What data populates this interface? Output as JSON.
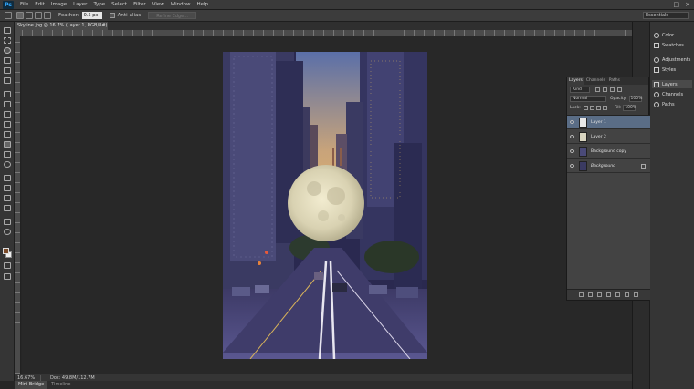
{
  "menubar": {
    "logo": "Ps",
    "items": [
      "File",
      "Edit",
      "Image",
      "Layer",
      "Type",
      "Select",
      "Filter",
      "View",
      "Window",
      "Help"
    ],
    "window_controls": [
      "–",
      "□",
      "×"
    ]
  },
  "options": {
    "feather_label": "Feather:",
    "feather_value": "0.5 px",
    "anti_alias_label": "Anti-alias",
    "refine_edge_label": "Refine Edge...",
    "workspace": "Essentials"
  },
  "document": {
    "tab_title": "Skyline.jpg @ 16.7% (Layer 1, RGB/8#) ×",
    "zoom": "16.67%",
    "doc_size": "Doc: 49.8M/112.7M"
  },
  "bottom_tabs": [
    "Mini Bridge",
    "Timeline"
  ],
  "dock": {
    "items": [
      "Color",
      "Swatches",
      "Adjustments",
      "Styles",
      "Layers",
      "Channels",
      "Paths"
    ]
  },
  "layers_panel": {
    "tabs": [
      "Layers",
      "Channels",
      "Paths"
    ],
    "filter_kind": "Kind",
    "blend_mode": "Normal",
    "opacity_label": "Opacity:",
    "opacity_value": "100%",
    "lock_label": "Lock:",
    "fill_label": "Fill:",
    "fill_value": "100%",
    "layers": [
      {
        "name": "Layer 1",
        "selected": true
      },
      {
        "name": "Layer 2",
        "selected": false
      },
      {
        "name": "Background copy",
        "selected": false
      },
      {
        "name": "Background",
        "selected": false
      }
    ]
  },
  "colors": {
    "foreground": "#7b4b2a",
    "background": "#f0f0f0",
    "selection_highlight": "#5a6d86",
    "ps_blue": "#31a8ff"
  }
}
